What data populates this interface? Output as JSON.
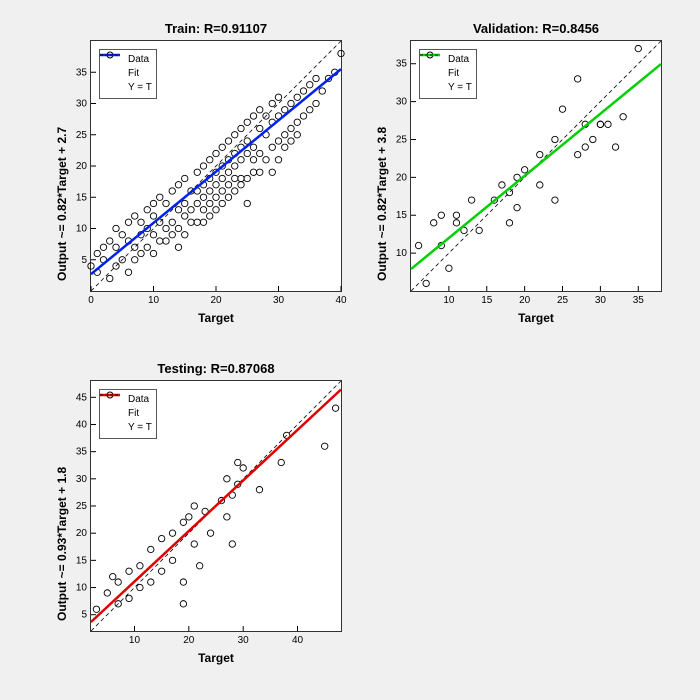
{
  "chart_data": [
    {
      "id": "train",
      "type": "scatter",
      "title": "Train: R=0.91107",
      "xlabel": "Target",
      "ylabel": "Output ~= 0.82*Target + 2.7",
      "xlim": [
        0,
        40
      ],
      "ylim": [
        0,
        40
      ],
      "xticks": [
        0,
        10,
        20,
        30,
        40
      ],
      "yticks": [
        5,
        10,
        15,
        20,
        25,
        30,
        35
      ],
      "fit_color": "#0022ee",
      "fit_slope": 0.82,
      "fit_intercept": 2.7,
      "yt_line": true,
      "legend": {
        "data": "Data",
        "fit": "Fit",
        "yt": "Y = T"
      },
      "data": [
        [
          0,
          4
        ],
        [
          1,
          6
        ],
        [
          1,
          3
        ],
        [
          2,
          7
        ],
        [
          2,
          5
        ],
        [
          3,
          2
        ],
        [
          3,
          8
        ],
        [
          4,
          4
        ],
        [
          4,
          7
        ],
        [
          4,
          10
        ],
        [
          5,
          5
        ],
        [
          5,
          9
        ],
        [
          6,
          3
        ],
        [
          6,
          8
        ],
        [
          6,
          11
        ],
        [
          7,
          7
        ],
        [
          7,
          5
        ],
        [
          7,
          12
        ],
        [
          8,
          11
        ],
        [
          8,
          6
        ],
        [
          8,
          9
        ],
        [
          9,
          7
        ],
        [
          9,
          13
        ],
        [
          9,
          10
        ],
        [
          10,
          6
        ],
        [
          10,
          9
        ],
        [
          10,
          12
        ],
        [
          10,
          14
        ],
        [
          11,
          8
        ],
        [
          11,
          11
        ],
        [
          11,
          15
        ],
        [
          12,
          10
        ],
        [
          12,
          14
        ],
        [
          12,
          8
        ],
        [
          13,
          11
        ],
        [
          13,
          16
        ],
        [
          13,
          9
        ],
        [
          14,
          10
        ],
        [
          14,
          13
        ],
        [
          14,
          17
        ],
        [
          14,
          7
        ],
        [
          15,
          12
        ],
        [
          15,
          14
        ],
        [
          15,
          18
        ],
        [
          15,
          9
        ],
        [
          16,
          11
        ],
        [
          16,
          16
        ],
        [
          16,
          13
        ],
        [
          17,
          14
        ],
        [
          17,
          19
        ],
        [
          17,
          11
        ],
        [
          17,
          16
        ],
        [
          18,
          13
        ],
        [
          18,
          17
        ],
        [
          18,
          20
        ],
        [
          18,
          11
        ],
        [
          18,
          15
        ],
        [
          19,
          14
        ],
        [
          19,
          18
        ],
        [
          19,
          12
        ],
        [
          19,
          21
        ],
        [
          19,
          16
        ],
        [
          20,
          15
        ],
        [
          20,
          19
        ],
        [
          20,
          22
        ],
        [
          20,
          13
        ],
        [
          20,
          17
        ],
        [
          21,
          16
        ],
        [
          21,
          20
        ],
        [
          21,
          14
        ],
        [
          21,
          23
        ],
        [
          21,
          18
        ],
        [
          22,
          17
        ],
        [
          22,
          21
        ],
        [
          22,
          15
        ],
        [
          22,
          24
        ],
        [
          22,
          19
        ],
        [
          23,
          18
        ],
        [
          23,
          22
        ],
        [
          23,
          16
        ],
        [
          23,
          25
        ],
        [
          23,
          20
        ],
        [
          24,
          18
        ],
        [
          24,
          23
        ],
        [
          24,
          17
        ],
        [
          24,
          26
        ],
        [
          24,
          21
        ],
        [
          25,
          14
        ],
        [
          25,
          24
        ],
        [
          25,
          18
        ],
        [
          25,
          27
        ],
        [
          25,
          22
        ],
        [
          26,
          19
        ],
        [
          26,
          23
        ],
        [
          26,
          21
        ],
        [
          26,
          28
        ],
        [
          27,
          22
        ],
        [
          27,
          26
        ],
        [
          27,
          19
        ],
        [
          27,
          29
        ],
        [
          28,
          21
        ],
        [
          28,
          25
        ],
        [
          28,
          28
        ],
        [
          29,
          23
        ],
        [
          29,
          27
        ],
        [
          29,
          19
        ],
        [
          29,
          30
        ],
        [
          30,
          24
        ],
        [
          30,
          28
        ],
        [
          30,
          21
        ],
        [
          30,
          31
        ],
        [
          31,
          25
        ],
        [
          31,
          29
        ],
        [
          31,
          23
        ],
        [
          32,
          26
        ],
        [
          32,
          30
        ],
        [
          32,
          24
        ],
        [
          33,
          27
        ],
        [
          33,
          31
        ],
        [
          33,
          25
        ],
        [
          34,
          28
        ],
        [
          34,
          32
        ],
        [
          35,
          29
        ],
        [
          35,
          33
        ],
        [
          36,
          30
        ],
        [
          36,
          34
        ],
        [
          37,
          32
        ],
        [
          38,
          34
        ],
        [
          39,
          35
        ],
        [
          40,
          38
        ]
      ]
    },
    {
      "id": "validation",
      "type": "scatter",
      "title": "Validation: R=0.8456",
      "xlabel": "Target",
      "ylabel": "Output ~= 0.82*Target + 3.8",
      "xlim": [
        5,
        38
      ],
      "ylim": [
        5,
        38
      ],
      "xticks": [
        10,
        15,
        20,
        25,
        30,
        35
      ],
      "yticks": [
        10,
        15,
        20,
        25,
        30,
        35
      ],
      "fit_color": "#00d000",
      "fit_slope": 0.82,
      "fit_intercept": 3.8,
      "yt_line": true,
      "legend": {
        "data": "Data",
        "fit": "Fit",
        "yt": "Y = T"
      },
      "data": [
        [
          6,
          11
        ],
        [
          7,
          6
        ],
        [
          8,
          14
        ],
        [
          9,
          11
        ],
        [
          9,
          15
        ],
        [
          10,
          8
        ],
        [
          11,
          15
        ],
        [
          11,
          14
        ],
        [
          12,
          13
        ],
        [
          13,
          17
        ],
        [
          14,
          13
        ],
        [
          16,
          17
        ],
        [
          17,
          19
        ],
        [
          18,
          14
        ],
        [
          18,
          18
        ],
        [
          19,
          16
        ],
        [
          19,
          20
        ],
        [
          20,
          21
        ],
        [
          22,
          19
        ],
        [
          22,
          23
        ],
        [
          24,
          17
        ],
        [
          24,
          25
        ],
        [
          25,
          29
        ],
        [
          27,
          33
        ],
        [
          27,
          23
        ],
        [
          28,
          24
        ],
        [
          28,
          27
        ],
        [
          29,
          25
        ],
        [
          30,
          27
        ],
        [
          30,
          27
        ],
        [
          31,
          27
        ],
        [
          32,
          24
        ],
        [
          33,
          28
        ],
        [
          35,
          37
        ]
      ]
    },
    {
      "id": "testing",
      "type": "scatter",
      "title": "Testing: R=0.87068",
      "xlabel": "Target",
      "ylabel": "Output ~= 0.93*Target + 1.8",
      "xlim": [
        2,
        48
      ],
      "ylim": [
        2,
        48
      ],
      "xticks": [
        10,
        20,
        30,
        40
      ],
      "yticks": [
        5,
        10,
        15,
        20,
        25,
        30,
        35,
        40,
        45
      ],
      "fit_color": "#e00000",
      "fit_slope": 0.93,
      "fit_intercept": 1.8,
      "yt_line": true,
      "legend": {
        "data": "Data",
        "fit": "Fit",
        "yt": "Y = T"
      },
      "data": [
        [
          3,
          6
        ],
        [
          5,
          9
        ],
        [
          6,
          12
        ],
        [
          7,
          7
        ],
        [
          7,
          11
        ],
        [
          9,
          8
        ],
        [
          9,
          13
        ],
        [
          11,
          10
        ],
        [
          11,
          14
        ],
        [
          13,
          11
        ],
        [
          13,
          17
        ],
        [
          15,
          13
        ],
        [
          15,
          19
        ],
        [
          17,
          15
        ],
        [
          17,
          20
        ],
        [
          19,
          7
        ],
        [
          19,
          22
        ],
        [
          19,
          11
        ],
        [
          20,
          23
        ],
        [
          21,
          18
        ],
        [
          21,
          25
        ],
        [
          22,
          14
        ],
        [
          23,
          24
        ],
        [
          24,
          20
        ],
        [
          26,
          26
        ],
        [
          27,
          23
        ],
        [
          27,
          30
        ],
        [
          28,
          18
        ],
        [
          28,
          27
        ],
        [
          29,
          29
        ],
        [
          29,
          33
        ],
        [
          30,
          32
        ],
        [
          33,
          28
        ],
        [
          37,
          33
        ],
        [
          38,
          38
        ],
        [
          45,
          36
        ],
        [
          47,
          43
        ]
      ]
    }
  ]
}
